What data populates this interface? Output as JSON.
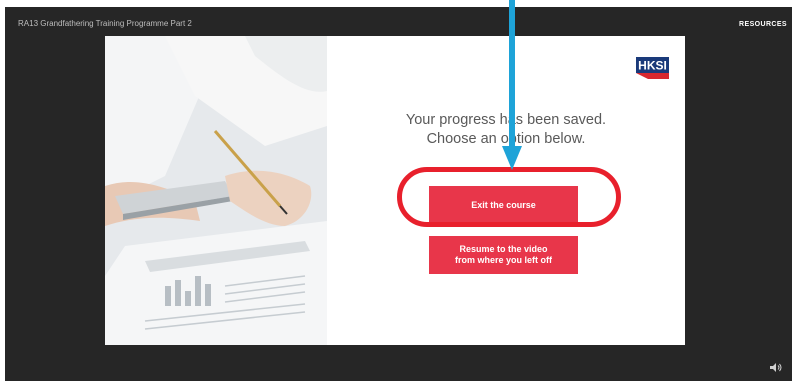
{
  "player": {
    "course_title": "RA13 Grandfathering Training Programme Part 2",
    "resources_label": "RESOURCES",
    "volume_icon": "volume-icon"
  },
  "slide": {
    "logo_text": "HKSI",
    "message_line1": "Your progress has been saved.",
    "message_line2": "Choose an option below.",
    "exit_button_label": "Exit the course",
    "resume_button_label_line1": "Resume to the video",
    "resume_button_label_line2": "from where you left off",
    "photo": "office-desk-photo"
  },
  "annotation": {
    "arrow_color": "#1ea3d8",
    "ring_color": "#e8202c"
  },
  "colors": {
    "player_bg": "#262626",
    "button_bg": "#e8364a",
    "logo_blue": "#1a3a7a",
    "logo_red": "#d7282f"
  }
}
